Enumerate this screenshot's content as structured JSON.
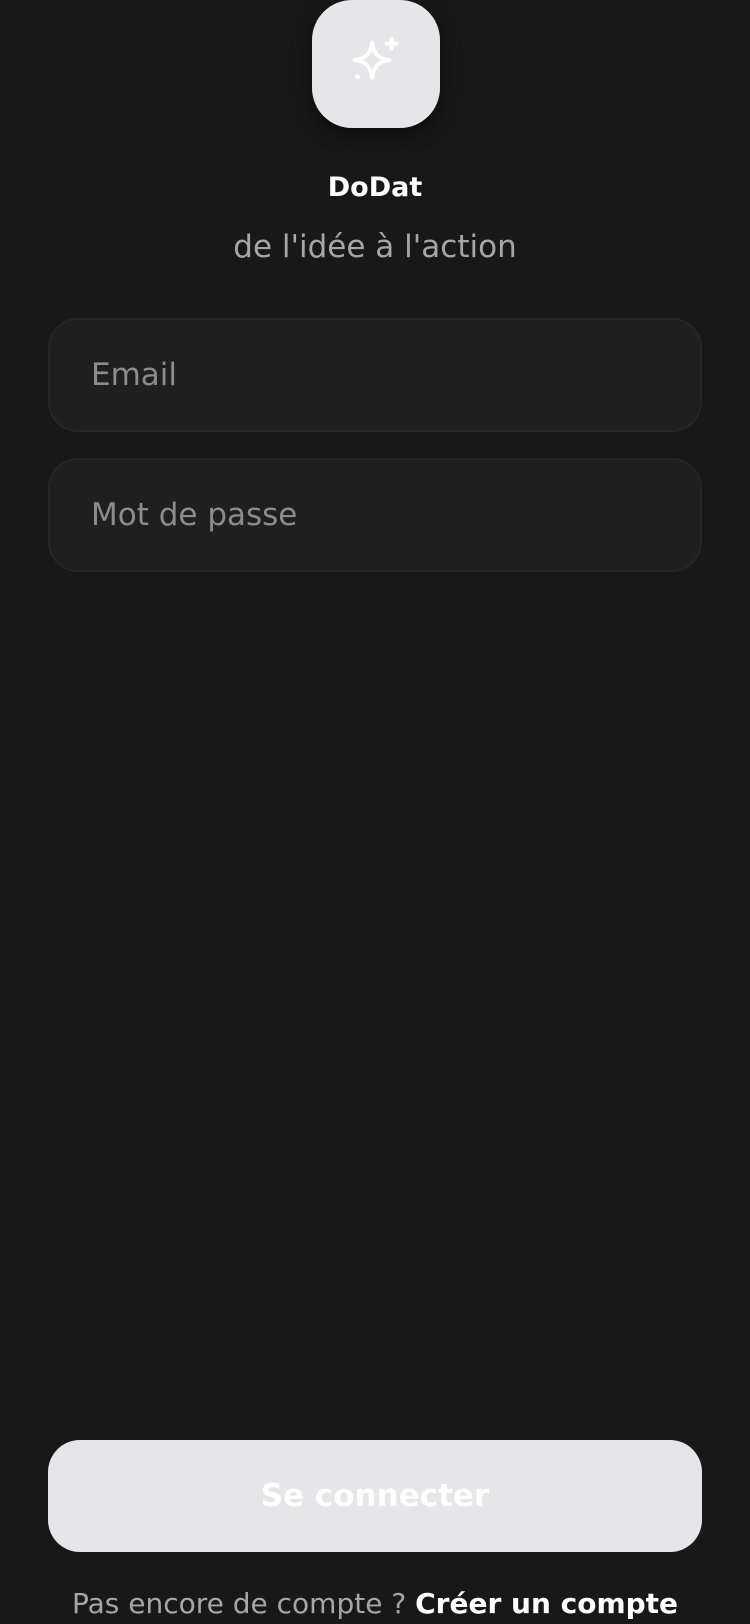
{
  "app": {
    "name": "DoDat",
    "tagline": "de l'idée à l'action",
    "logo_icon": "sparkles-icon"
  },
  "form": {
    "email": {
      "placeholder": "Email",
      "value": ""
    },
    "password": {
      "placeholder": "Mot de passe",
      "value": ""
    },
    "submit_label": "Se connecter"
  },
  "signup": {
    "prompt": "Pas encore de compte ?",
    "link_label": "Créer un compte"
  },
  "colors": {
    "background": "#181818",
    "field_background": "#1f1f1f",
    "button_background": "#e6e6e8",
    "secondary_text": "#a6a6a6"
  }
}
